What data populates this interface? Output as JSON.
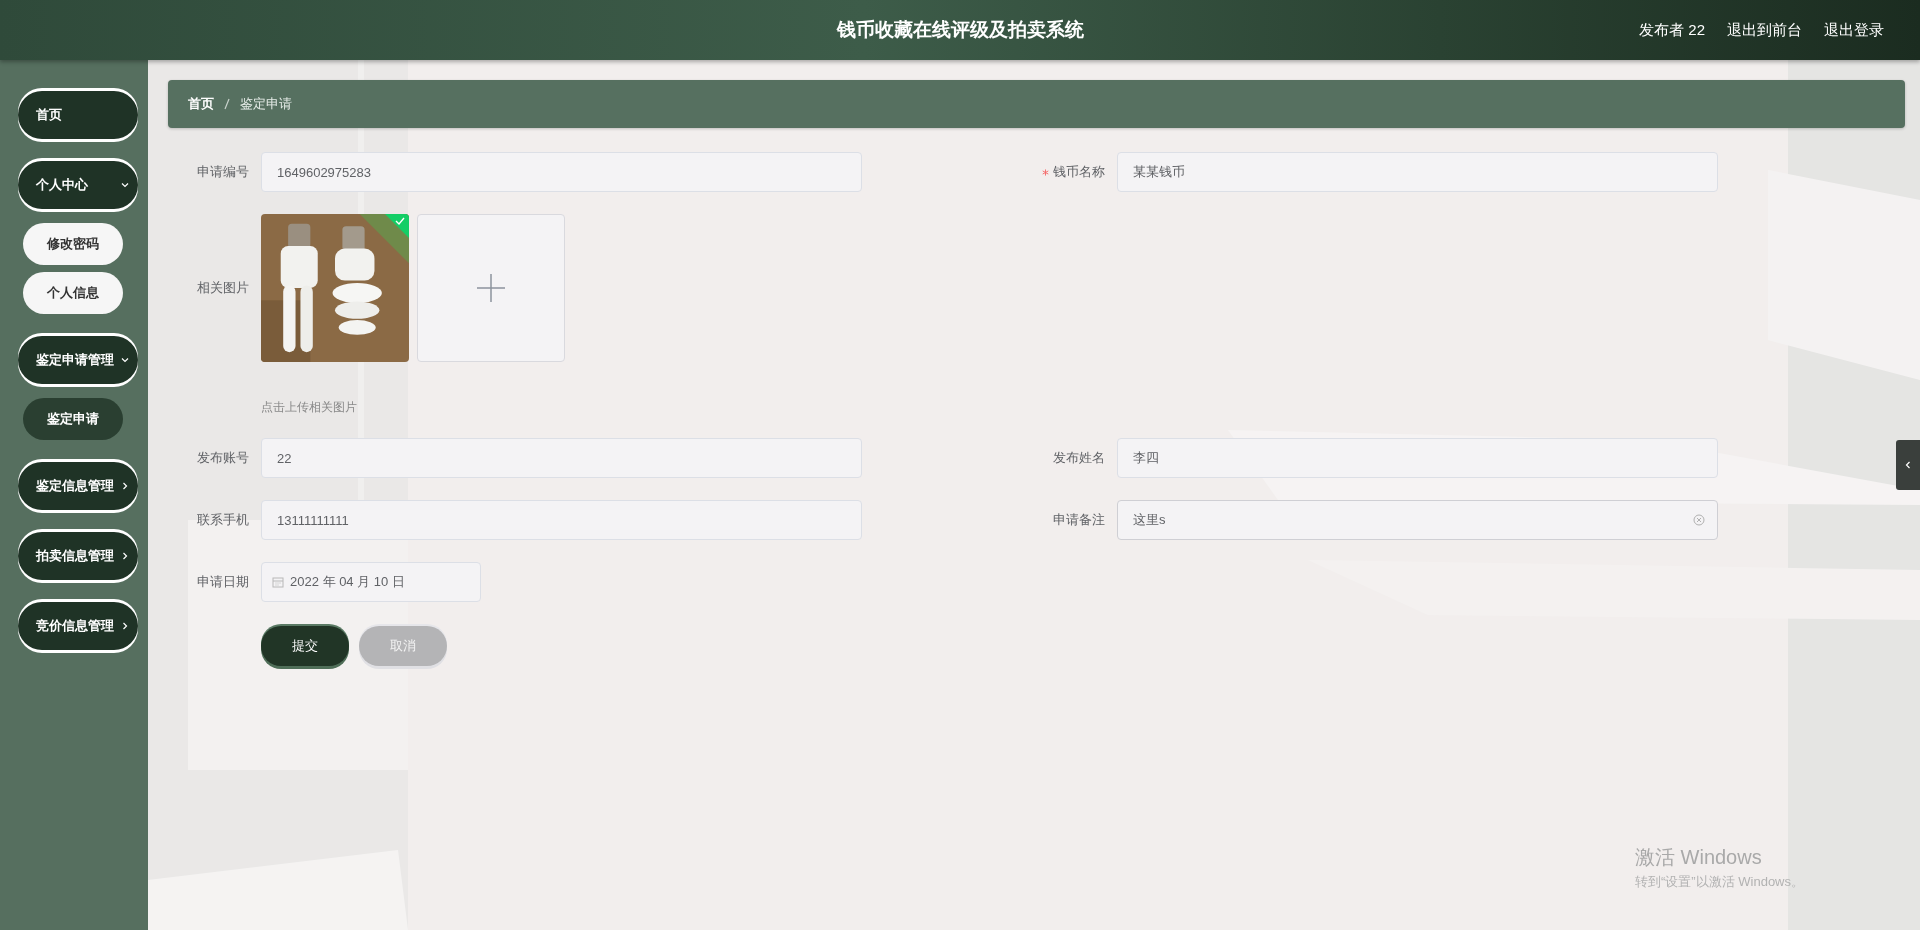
{
  "header": {
    "title": "钱币收藏在线评级及拍卖系统",
    "links": [
      "发布者 22",
      "退出到前台",
      "退出登录"
    ]
  },
  "sidebar": {
    "items": [
      {
        "label": "首页"
      },
      {
        "label": "个人中心",
        "expanded": true,
        "children": [
          {
            "label": "修改密码",
            "selected": false
          },
          {
            "label": "个人信息",
            "selected": false
          }
        ]
      },
      {
        "label": "鉴定申请管理",
        "expanded": true,
        "children": [
          {
            "label": "鉴定申请",
            "selected": true
          }
        ]
      },
      {
        "label": "鉴定信息管理",
        "expanded": false
      },
      {
        "label": "拍卖信息管理",
        "expanded": false
      },
      {
        "label": "竞价信息管理",
        "expanded": false
      }
    ]
  },
  "breadcrumb": [
    "首页",
    "鉴定申请"
  ],
  "form": {
    "rows": [
      [
        {
          "kind": "text",
          "label": "申请编号",
          "value": "1649602975283",
          "required": false,
          "focused": false
        },
        {
          "kind": "text",
          "label": "钱币名称",
          "value": "某某钱币",
          "required": true,
          "focused": false
        }
      ],
      [
        {
          "kind": "upload",
          "label": "相关图片",
          "images": [
            {
              "kind": "picture",
              "uploaded": true
            }
          ],
          "hint": "点击上传相关图片"
        }
      ],
      [
        {
          "kind": "text",
          "label": "发布账号",
          "value": "22",
          "required": false,
          "focused": false
        },
        {
          "kind": "text",
          "label": "发布姓名",
          "value": "李四",
          "required": false,
          "focused": false
        }
      ],
      [
        {
          "kind": "text",
          "label": "联系手机",
          "value": "13111111111",
          "required": false,
          "focused": false
        },
        {
          "kind": "text",
          "label": "申请备注",
          "value": "这里s",
          "required": false,
          "focused": true
        }
      ],
      [
        {
          "kind": "date",
          "label": "申请日期",
          "value": "2022 年 04 月 10 日"
        }
      ]
    ],
    "buttons": [
      {
        "label": "提交",
        "kind": "primary"
      },
      {
        "label": "取消",
        "kind": "secondary"
      }
    ]
  },
  "os_notice": {
    "title": "激活 Windows",
    "text": "转到“设置”以激活 Windows。"
  }
}
